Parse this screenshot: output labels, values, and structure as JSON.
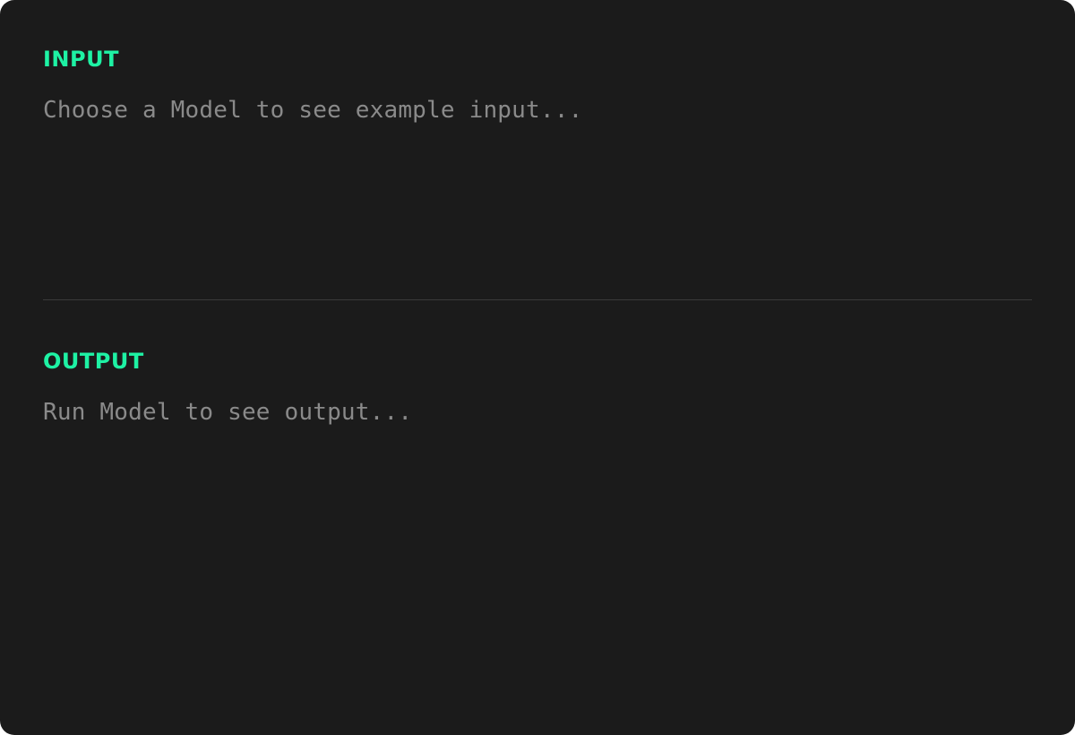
{
  "input": {
    "heading": "INPUT",
    "placeholder": "Choose a Model to see example input..."
  },
  "output": {
    "heading": "OUTPUT",
    "placeholder": "Run Model to see output..."
  },
  "colors": {
    "panel_background": "#1b1b1b",
    "heading_accent": "#1ef2a4",
    "placeholder_text": "#8a8a8a",
    "divider": "#3a3a3a"
  }
}
